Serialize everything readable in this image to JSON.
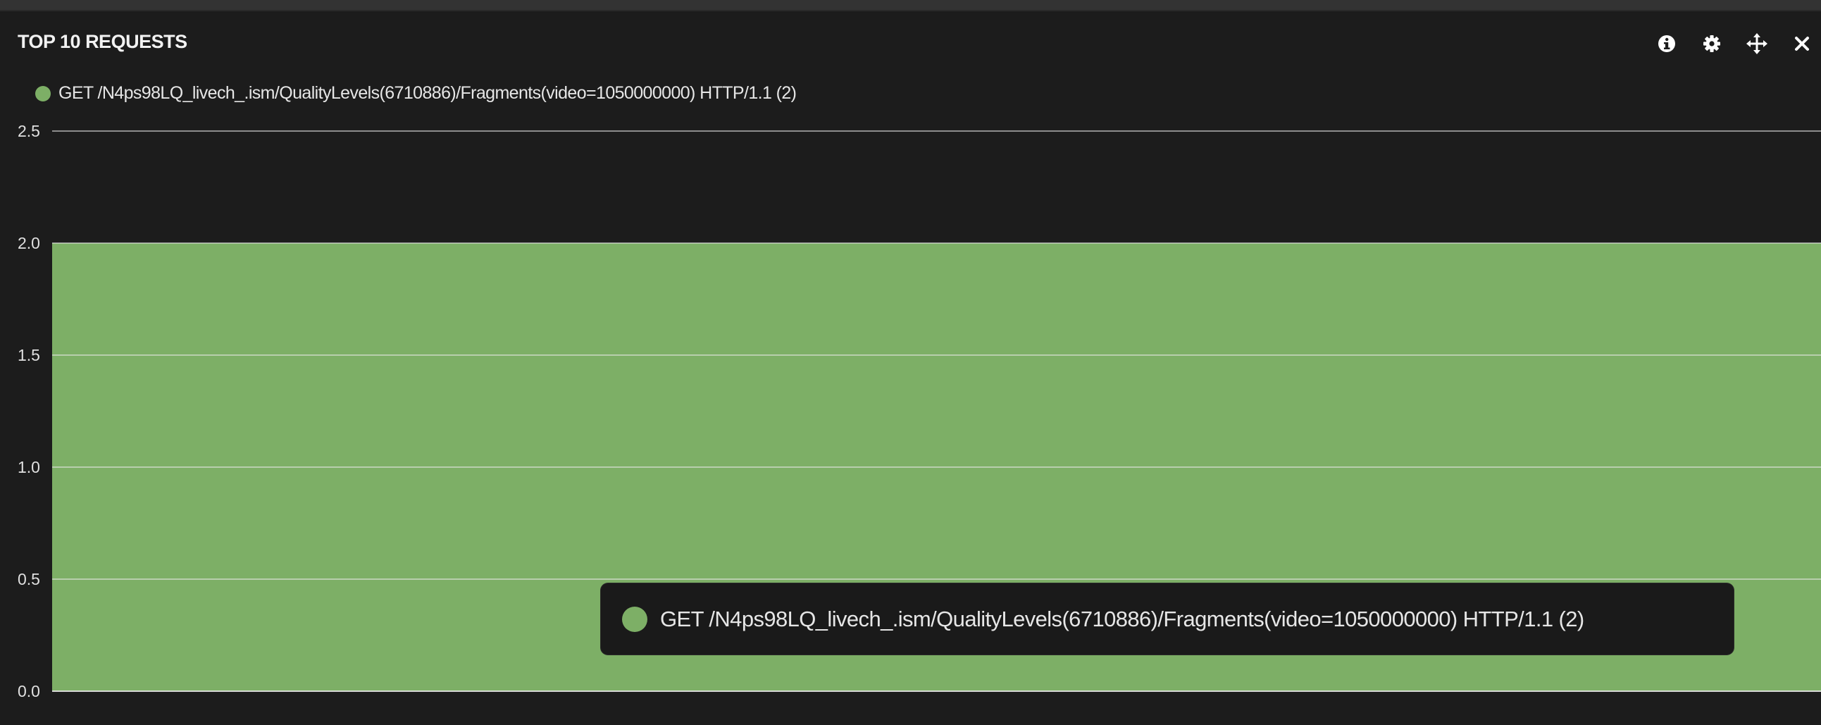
{
  "panel": {
    "title": "TOP 10 REQUESTS",
    "tools": [
      {
        "icon": "info-icon"
      },
      {
        "icon": "gear-icon"
      },
      {
        "icon": "move-icon"
      },
      {
        "icon": "close-icon"
      }
    ]
  },
  "legend": {
    "label": "GET /N4ps98LQ_livech_.ism/QualityLevels(6710886)/Fragments(video=1050000000) HTTP/1.1 (2)",
    "color": "#7daf66"
  },
  "tooltip": {
    "label": "GET /N4ps98LQ_livech_.ism/QualityLevels(6710886)/Fragments(video=1050000000) HTTP/1.1 (2)",
    "color": "#7daf66"
  },
  "chart_data": {
    "type": "area",
    "series": [
      {
        "name": "GET /N4ps98LQ_livech_.ism/QualityLevels(6710886)/Fragments(video=1050000000) HTTP/1.1 (2)",
        "values": [
          2,
          2
        ],
        "color": "#7daf66"
      }
    ],
    "ylim": [
      0,
      2.5
    ],
    "yticks": [
      "0.0",
      "0.5",
      "1.0",
      "1.5",
      "2.0",
      "2.5"
    ],
    "grid": true,
    "legend_position": "top-left",
    "title": "",
    "xlabel": "",
    "ylabel": ""
  }
}
